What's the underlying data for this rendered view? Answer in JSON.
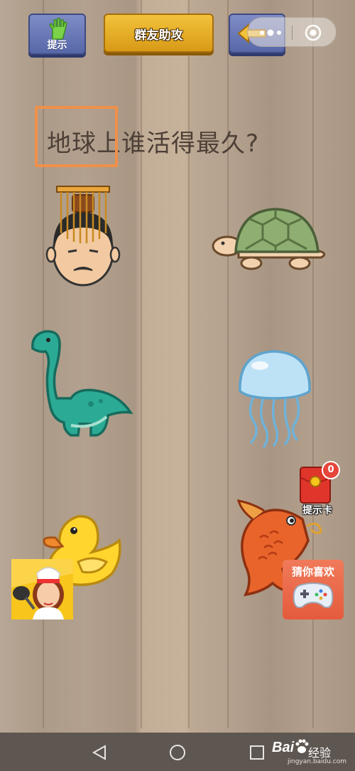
{
  "toolbar": {
    "hint_label": "提示",
    "help_label": "群友助攻"
  },
  "question": {
    "text": "地球上谁活得最久?"
  },
  "options": [
    {
      "name": "emperor-head"
    },
    {
      "name": "turtle"
    },
    {
      "name": "dinosaur"
    },
    {
      "name": "jellyfish"
    },
    {
      "name": "rubber-duck"
    },
    {
      "name": "carp-fish"
    }
  ],
  "hint_card": {
    "label": "提示卡",
    "count": "0"
  },
  "guess_card": {
    "label": "猜你喜欢"
  },
  "watermark": {
    "brand": "Bai",
    "brand_suffix": "经验",
    "url": "jingyan.baidu.com"
  },
  "colors": {
    "highlight": "#f0904a",
    "button_blue": "#5767a8",
    "button_gold": "#e3a821"
  }
}
